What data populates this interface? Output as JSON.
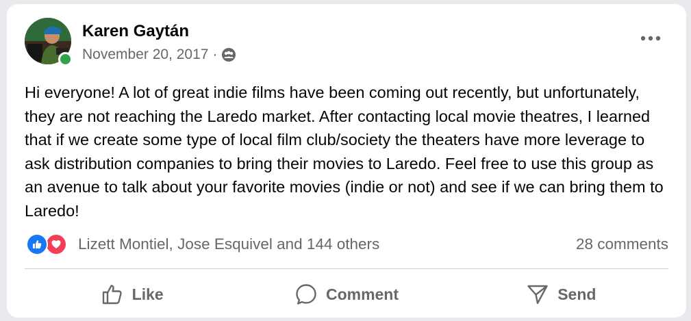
{
  "post": {
    "author_name": "Karen Gaytán",
    "date": "November 20, 2017",
    "separator": "·",
    "audience_icon": "group-audience-icon",
    "more_icon": "more-options-icon",
    "body": "Hi everyone! A lot of great indie films have been coming out recently, but unfortunately, they are not reaching the Laredo market. After contacting local movie theatres, I learned that if we create some type of local film club/society the theaters have more leverage to ask distribution companies to bring their movies to Laredo. Feel free to use this group as an avenue to talk about your favorite movies (indie or not) and see if we can bring them to Laredo!",
    "online_status_color": "#31a24c"
  },
  "engagement": {
    "reaction_icons": [
      "like-reaction-icon",
      "love-reaction-icon"
    ],
    "reactors": "Lizett Montiel, Jose Esquivel and 144 others",
    "comments": "28 comments"
  },
  "actions": {
    "like_label": "Like",
    "comment_label": "Comment",
    "send_label": "Send"
  },
  "colors": {
    "like_blue": "#1877f2",
    "love_red": "#f33e58",
    "secondary_text": "#65676b",
    "primary_text": "#050505"
  }
}
